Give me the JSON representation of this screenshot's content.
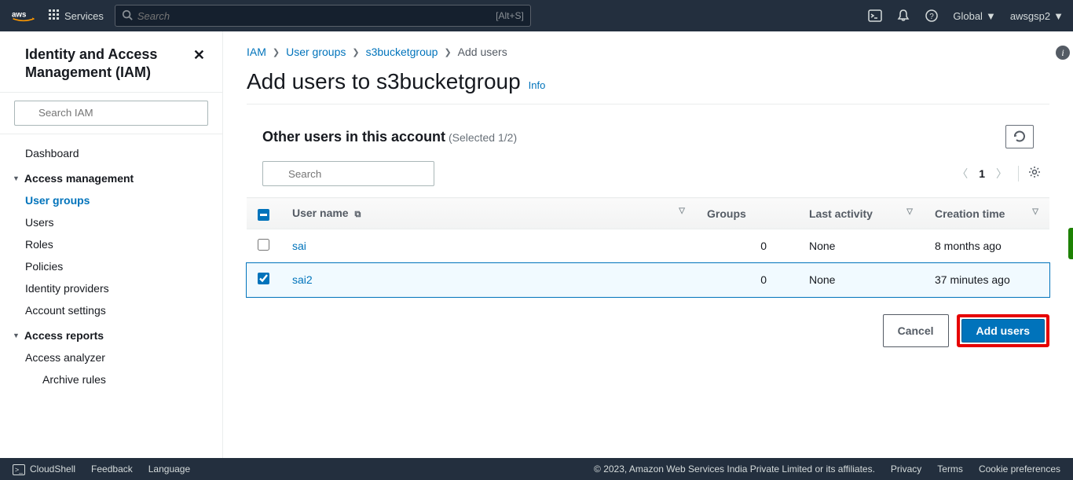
{
  "topnav": {
    "services_label": "Services",
    "search_placeholder": "Search",
    "search_hint": "[Alt+S]",
    "region": "Global",
    "account": "awsgsp2"
  },
  "sidebar": {
    "title": "Identity and Access Management (IAM)",
    "search_placeholder": "Search IAM",
    "items": [
      {
        "label": "Dashboard",
        "type": "item"
      },
      {
        "label": "Access management",
        "type": "section"
      },
      {
        "label": "User groups",
        "type": "item",
        "active": true
      },
      {
        "label": "Users",
        "type": "item"
      },
      {
        "label": "Roles",
        "type": "item"
      },
      {
        "label": "Policies",
        "type": "item"
      },
      {
        "label": "Identity providers",
        "type": "item"
      },
      {
        "label": "Account settings",
        "type": "item"
      },
      {
        "label": "Access reports",
        "type": "section"
      },
      {
        "label": "Access analyzer",
        "type": "item"
      },
      {
        "label": "Archive rules",
        "type": "sub"
      }
    ]
  },
  "breadcrumb": {
    "items": [
      "IAM",
      "User groups",
      "s3bucketgroup"
    ],
    "current": "Add users"
  },
  "page": {
    "title": "Add users to s3bucketgroup",
    "info": "Info"
  },
  "panel": {
    "title": "Other users in this account",
    "selected": "(Selected 1/2)",
    "search_placeholder": "Search",
    "page": "1"
  },
  "table": {
    "columns": [
      "User name",
      "Groups",
      "Last activity",
      "Creation time"
    ],
    "rows": [
      {
        "selected": false,
        "name": "sai",
        "groups": "0",
        "last": "None",
        "created": "8 months ago"
      },
      {
        "selected": true,
        "name": "sai2",
        "groups": "0",
        "last": "None",
        "created": "37 minutes ago"
      }
    ]
  },
  "actions": {
    "cancel": "Cancel",
    "add": "Add users"
  },
  "footer": {
    "cloudshell": "CloudShell",
    "feedback": "Feedback",
    "language": "Language",
    "copyright": "© 2023, Amazon Web Services India Private Limited or its affiliates.",
    "privacy": "Privacy",
    "terms": "Terms",
    "cookies": "Cookie preferences"
  }
}
